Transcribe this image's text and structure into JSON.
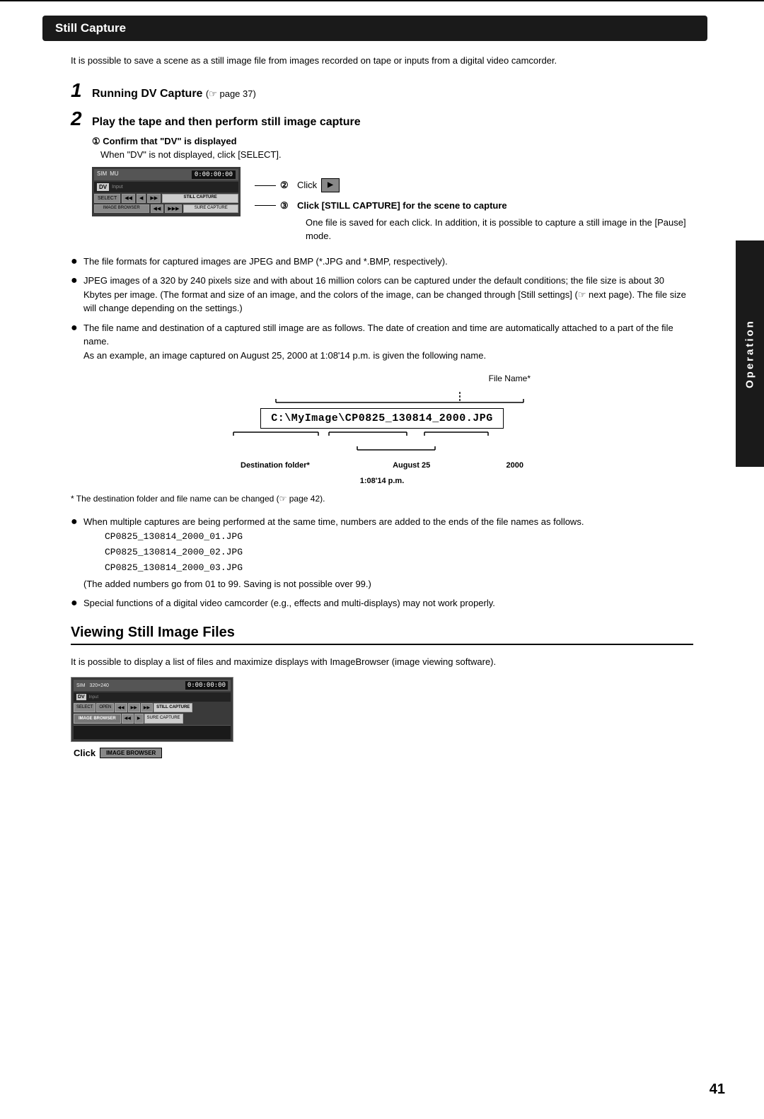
{
  "page": {
    "number": "41",
    "top_rule": true
  },
  "section": {
    "title": "Still Capture",
    "intro": "It is possible to save a scene as a still image file from images recorded on tape or inputs from a digital video camcorder."
  },
  "steps": [
    {
      "number": "1",
      "text": "Running DV Capture",
      "page_ref": "(☞ page 37)"
    },
    {
      "number": "2",
      "text": "Play the tape and then perform still image capture"
    }
  ],
  "substep1": {
    "label": "① Confirm that \"DV\" is displayed",
    "note": "When \"DV\" is not displayed, click [SELECT]."
  },
  "callout2": {
    "number": "②",
    "text": "Click",
    "button_label": "▶︎"
  },
  "callout3": {
    "number": "③",
    "text": "Click [STILL CAPTURE] for the scene to capture",
    "detail": "One file is saved for each click. In addition, it is possible to capture a still image in the [Pause] mode."
  },
  "ui_screenshot": {
    "top_labels": [
      "SIM",
      "MU"
    ],
    "dv_label": "DV",
    "timecode": "0:00:00:00",
    "buttons_row1": [
      "SELECT",
      "◀◀",
      "◀",
      "▶▶",
      "STILL CAPTURE"
    ],
    "buttons_row2": [
      "IMAGE BROWSER",
      "◀◀",
      "▶▶▶",
      "SURE CAPTURE"
    ]
  },
  "bullets": [
    {
      "text": "The file formats for captured images are JPEG and BMP (*.JPG and *.BMP, respectively)."
    },
    {
      "text": "JPEG images of a 320 by 240 pixels size and with about 16 million colors can be captured under the default conditions; the file size is about 30 Kbytes per image. (The format and size of an image, and the colors of the image, can be changed through [Still settings] (☞ next page). The file size will change depending on the settings.)"
    },
    {
      "text": "The file name and destination of a captured still image are as follows. The date of creation and time are automatically attached to a part of the file name.\nAs an example, an image captured on August 25, 2000 at 1:08'14 p.m. is given the following name."
    }
  ],
  "filename_diagram": {
    "file_name_label": "File Name*",
    "filename": "C:\\MyImage\\CP0825_130814_2000.JPG",
    "destination_folder_label": "Destination folder*",
    "date_label": "August 25",
    "year_label": "2000",
    "time_label": "1:08'14 p.m."
  },
  "footer_note": "* The destination folder and file name can be changed (☞ page 42).",
  "additional_bullets": [
    {
      "text": "When multiple captures are being performed at the same time, numbers are added to the ends of the file names as follows.",
      "examples": [
        "CP0825_130814_2000_01.JPG",
        "CP0825_130814_2000_02.JPG",
        "CP0825_130814_2000_03.JPG"
      ],
      "note": "(The added numbers go from 01 to 99. Saving is not possible over 99.)"
    },
    {
      "text": "Special functions of a digital video camcorder (e.g., effects and multi-displays) may not work properly."
    }
  ],
  "viewing_section": {
    "title": "Viewing Still Image Files",
    "intro": "It is possible to display a list of files and maximize displays with ImageBrowser (image viewing software).",
    "click_label": "Click",
    "click_button": "IMAGE BROWSER"
  },
  "ui_screenshot2": {
    "top_labels": [
      "SIM",
      "320×240"
    ],
    "input_label": "DV",
    "timecode": "0:00:00:00",
    "buttons_row1": [
      "SELECT",
      "OPEN",
      "◀◀",
      "▶▶",
      "▶▶",
      "STILL CAPTURE"
    ],
    "buttons_row2": [
      "IMAGE BROWSER",
      "◀◀",
      "▶",
      "SURE CAPTURE"
    ]
  },
  "sidebar": {
    "label": "Operation"
  }
}
